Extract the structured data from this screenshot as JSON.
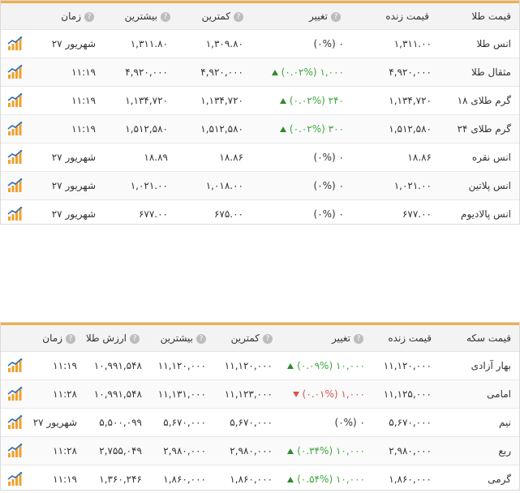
{
  "colors": {
    "accent": "#f0ad4e",
    "up": "#3ea63e",
    "down": "#d9534f",
    "chart_icon": "#f0a030"
  },
  "gold_table": {
    "headers": {
      "name": "قیمت طلا",
      "live": "قیمت زنده",
      "change": "تغییر",
      "low": "کمترین",
      "high": "بیشترین",
      "time": "زمان"
    },
    "rows": [
      {
        "name": "انس طلا",
        "live": "۱,۳۱۱.۰۰",
        "change": "(۰%) ۰",
        "direction": "none",
        "low": "۱,۳۰۹.۸۰",
        "high": "۱,۳۱۱.۸۰",
        "time": "۲۷ شهریور"
      },
      {
        "name": "مثقال طلا",
        "live": "۴,۹۲۰,۰۰۰",
        "change": "(۰.۰۲%) ۱,۰۰۰",
        "direction": "up",
        "low": "۴,۹۲۰,۰۰۰",
        "high": "۴,۹۲۰,۰۰۰",
        "time": "۱۱:۱۹"
      },
      {
        "name": "گرم طلای ۱۸",
        "live": "۱,۱۳۴,۷۲۰",
        "change": "(۰.۰۲%) ۲۴۰",
        "direction": "up",
        "low": "۱,۱۳۴,۷۲۰",
        "high": "۱,۱۳۴,۷۲۰",
        "time": "۱۱:۱۹"
      },
      {
        "name": "گرم طلای ۲۴",
        "live": "۱,۵۱۲,۵۸۰",
        "change": "(۰.۰۲%) ۳۰۰",
        "direction": "up",
        "low": "۱,۵۱۲,۵۸۰",
        "high": "۱,۵۱۲,۵۸۰",
        "time": "۱۱:۱۹"
      },
      {
        "name": "انس نقره",
        "live": "۱۸.۸۶",
        "change": "(۰%) ۰",
        "direction": "none",
        "low": "۱۸.۸۶",
        "high": "۱۸.۸۹",
        "time": "۲۷ شهریور"
      },
      {
        "name": "انس پلاتین",
        "live": "۱,۰۲۱.۰۰",
        "change": "(۰%) ۰",
        "direction": "none",
        "low": "۱,۰۱۸.۰۰",
        "high": "۱,۰۲۱.۰۰",
        "time": "۲۷ شهریور"
      },
      {
        "name": "انس پالادیوم",
        "live": "۶۷۷.۰۰",
        "change": "(۰%) ۰",
        "direction": "none",
        "low": "۶۷۵.۰۰",
        "high": "۶۷۷.۰۰",
        "time": "۲۷ شهریور"
      }
    ]
  },
  "coin_table": {
    "headers": {
      "name": "قیمت سکه",
      "live": "قیمت زنده",
      "change": "تغییر",
      "low": "کمترین",
      "high": "بیشترین",
      "gold_value": "ارزش طلا",
      "time": "زمان"
    },
    "rows": [
      {
        "name": "بهار آزادی",
        "live": "۱۱,۱۲۰,۰۰۰",
        "change": "(۰.۰۹%) ۱۰,۰۰۰",
        "direction": "up",
        "low": "۱۱,۱۲۰,۰۰۰",
        "high": "۱۱,۱۲۰,۰۰۰",
        "gold_value": "۱۰,۹۹۱,۵۴۸",
        "time": "۱۱:۱۹"
      },
      {
        "name": "امامی",
        "live": "۱۱,۱۲۵,۰۰۰",
        "change": "(۰.۰۱%) ۱,۰۰۰",
        "direction": "down",
        "low": "۱۱,۱۲۳,۰۰۰",
        "high": "۱۱,۱۳۱,۰۰۰",
        "gold_value": "۱۰,۹۹۱,۵۴۸",
        "time": "۱۱:۲۸"
      },
      {
        "name": "نیم",
        "live": "۵,۶۷۰,۰۰۰",
        "change": "(۰%) ۰",
        "direction": "none",
        "low": "۵,۶۷۰,۰۰۰",
        "high": "۵,۶۷۰,۰۰۰",
        "gold_value": "۵,۵۰۰,۰۹۹",
        "time": "۲۷ شهریور"
      },
      {
        "name": "ربع",
        "live": "۲,۹۸۰,۰۰۰",
        "change": "(۰.۳۴%) ۱۰,۰۰۰",
        "direction": "up",
        "low": "۲,۹۸۰,۰۰۰",
        "high": "۲,۹۸۰,۰۰۰",
        "gold_value": "۲,۷۵۵,۰۴۹",
        "time": "۱۱:۲۸"
      },
      {
        "name": "گرمی",
        "live": "۱,۸۶۰,۰۰۰",
        "change": "(۰.۵۴%) ۱۰,۰۰۰",
        "direction": "up",
        "low": "۱,۸۶۰,۰۰۰",
        "high": "۱,۸۶۰,۰۰۰",
        "gold_value": "۱,۳۶۰,۲۴۶",
        "time": "۱۱:۱۹"
      }
    ]
  }
}
